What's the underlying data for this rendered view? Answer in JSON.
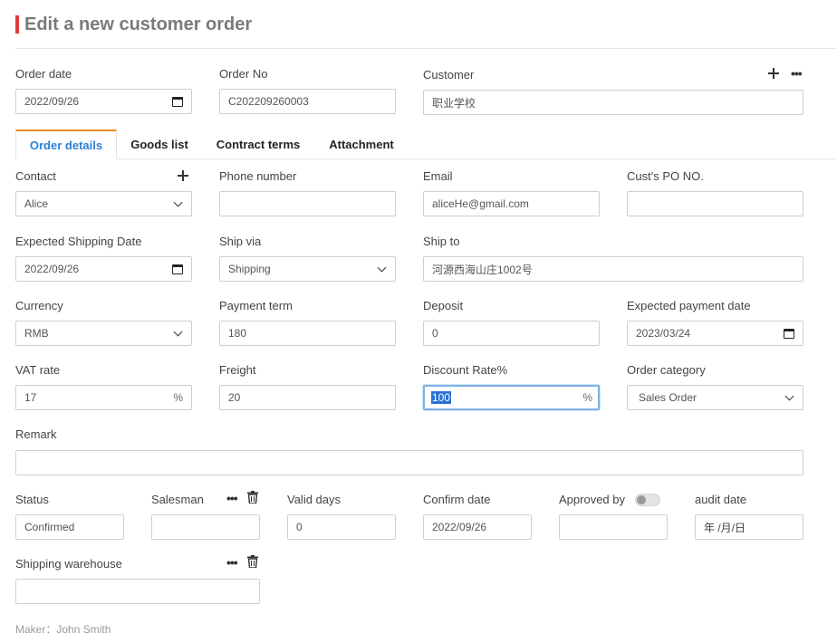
{
  "page_title": "Edit a new customer order",
  "header": {
    "order_date": {
      "label": "Order date",
      "value": "2022/09/26"
    },
    "order_no": {
      "label": "Order No",
      "value": "C202209260003"
    },
    "customer": {
      "label": "Customer",
      "value": "职业学校"
    }
  },
  "tabs": [
    {
      "label": "Order details",
      "active": true
    },
    {
      "label": "Goods list",
      "active": false
    },
    {
      "label": "Contract terms",
      "active": false
    },
    {
      "label": "Attachment",
      "active": false
    }
  ],
  "details": {
    "contact": {
      "label": "Contact",
      "value": "Alice"
    },
    "phone": {
      "label": "Phone number",
      "value": ""
    },
    "email": {
      "label": "Email",
      "value": "aliceHe@gmail.com"
    },
    "cust_po": {
      "label": "Cust's PO NO.",
      "value": ""
    },
    "expected_shipping_date": {
      "label": "Expected Shipping Date",
      "value": "2022/09/26"
    },
    "ship_via": {
      "label": "Ship via",
      "value": "Shipping"
    },
    "ship_to": {
      "label": "Ship to",
      "value": "河源西海山庄1002号"
    },
    "currency": {
      "label": "Currency",
      "value": "RMB"
    },
    "payment_term": {
      "label": "Payment term",
      "value": "180"
    },
    "deposit": {
      "label": "Deposit",
      "value": "0"
    },
    "expected_payment_date": {
      "label": "Expected payment date",
      "value": "2023/03/24"
    },
    "vat_rate": {
      "label": "VAT rate",
      "value": "17",
      "suffix": "%"
    },
    "freight": {
      "label": "Freight",
      "value": "20"
    },
    "discount_rate": {
      "label": "Discount Rate%",
      "value": "100",
      "suffix": "%"
    },
    "order_category": {
      "label": "Order category",
      "value": "Sales Order"
    },
    "remark": {
      "label": "Remark",
      "value": ""
    },
    "status": {
      "label": "Status",
      "value": "Confirmed"
    },
    "salesman": {
      "label": "Salesman",
      "value": ""
    },
    "valid_days": {
      "label": "Valid days",
      "value": "0"
    },
    "confirm_date": {
      "label": "Confirm date",
      "value": "2022/09/26"
    },
    "approved_by": {
      "label": "Approved by",
      "value": "",
      "toggle_on": false
    },
    "audit_date": {
      "label": "audit date",
      "placeholder": "年 /月/日"
    },
    "shipping_warehouse": {
      "label": "Shipping warehouse",
      "value": ""
    }
  },
  "maker": "Maker：John Smith",
  "icons": {
    "add": "plus-icon",
    "more": "more-dots-icon",
    "delete": "trash-icon",
    "calendar": "calendar-icon",
    "dropdown": "chevron-down-icon"
  },
  "colors": {
    "title_accent": "#e03a3e",
    "tab_active_top": "#f08a24",
    "tab_active_text": "#2d7fd3",
    "selection": "#2d72d2"
  }
}
